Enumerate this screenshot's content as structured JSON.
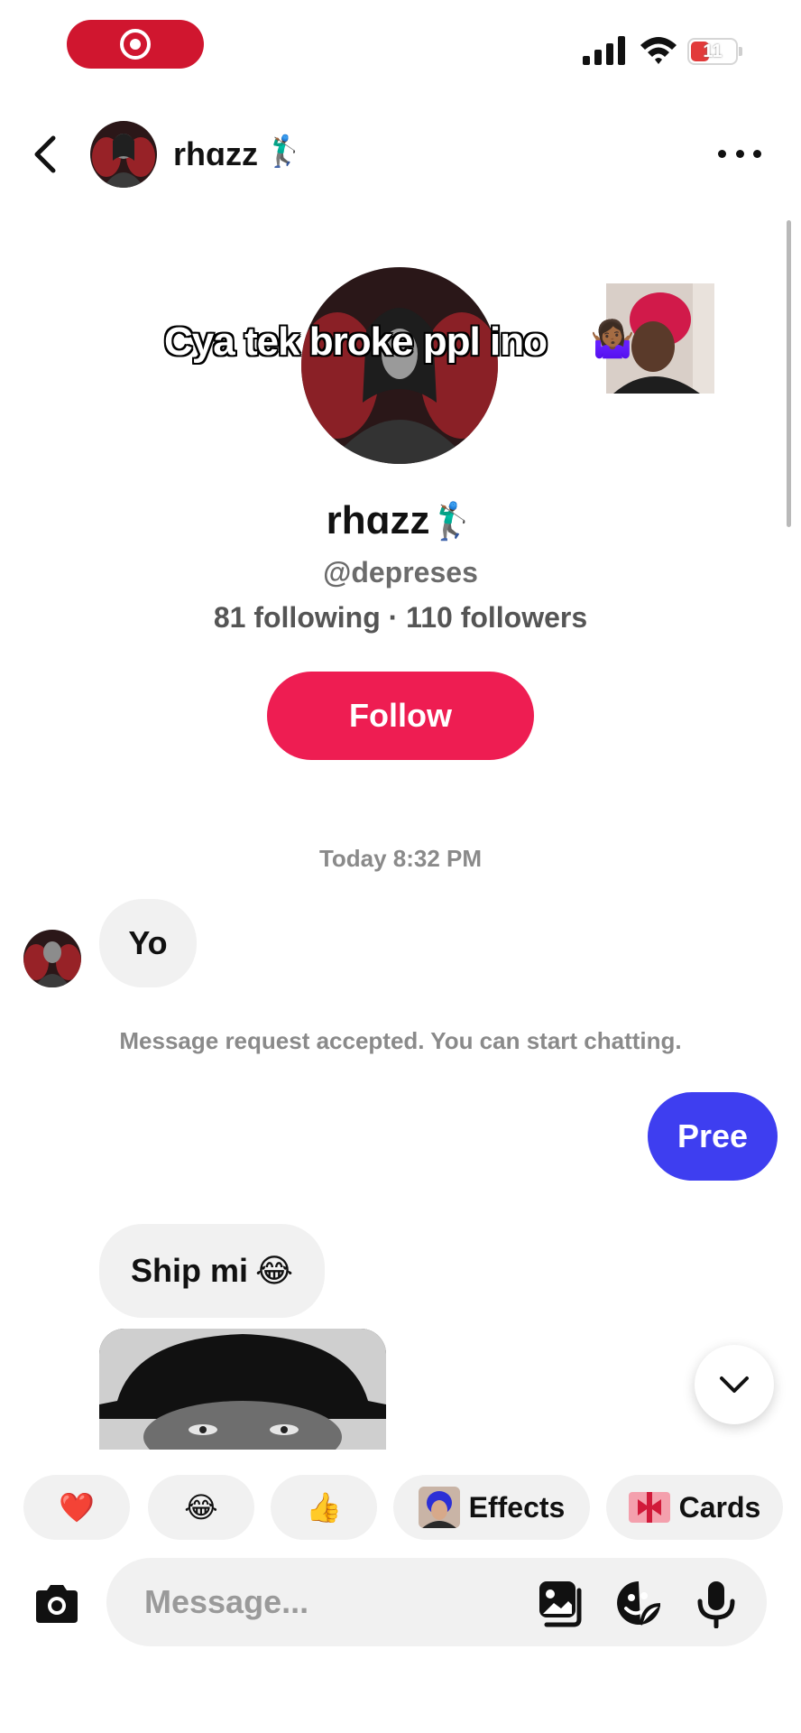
{
  "status": {
    "battery": "11"
  },
  "header": {
    "name": "rhɑzz",
    "emoji": "🏌🏾‍♂️"
  },
  "profile": {
    "overlay_caption": "Cya tek broke ppl ino",
    "overlay_emoji": "🤷🏾‍♀️",
    "name": "rhɑzz",
    "name_emoji": "🏌🏾‍♂️",
    "handle": "@depreses",
    "stats": "81 following · 110 followers",
    "follow_label": "Follow"
  },
  "chat": {
    "timestamp": "Today 8:32 PM",
    "messages": [
      {
        "from": "them",
        "text": "Yo"
      },
      {
        "from": "system",
        "text": "Message request accepted. You can start chatting."
      },
      {
        "from": "me",
        "text": "Pree"
      },
      {
        "from": "them",
        "text": "Ship mi",
        "emoji": "😂"
      }
    ]
  },
  "quick_actions": [
    {
      "icon": "heart-icon",
      "glyph": "❤️"
    },
    {
      "icon": "laughing-icon",
      "glyph": "😂"
    },
    {
      "icon": "thumbs-up-icon",
      "glyph": "👍"
    },
    {
      "label": "Effects"
    },
    {
      "label": "Cards"
    }
  ],
  "composer": {
    "placeholder": "Message..."
  },
  "colors": {
    "follow": "#ee1d52",
    "outgoing_bubble": "#3e3ef0",
    "incoming_bubble": "#f1f1f1",
    "record_pill": "#d0162f"
  }
}
